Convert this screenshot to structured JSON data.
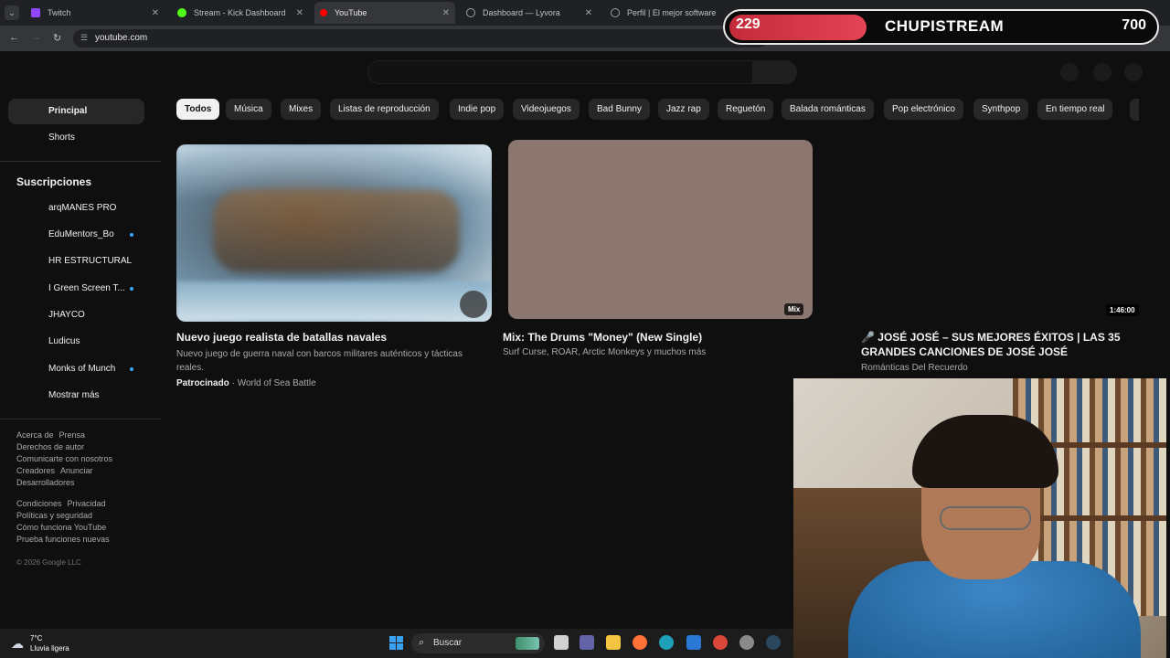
{
  "browser": {
    "tabs": [
      {
        "title": "Twitch",
        "color": "#9146ff"
      },
      {
        "title": "Stream - Kick Dashboard",
        "color": "#53fc18"
      },
      {
        "title": "YouTube",
        "color": "#ff0000"
      },
      {
        "title": "Dashboard — Lyvora",
        "color": "#9aa0a6"
      },
      {
        "title": "Perfil | El mejor software para p",
        "color": "#9aa0a6"
      }
    ],
    "url": "youtube.com"
  },
  "overlay": {
    "left_count": "229",
    "channel": "CHUPISTREAM",
    "right_count": "700"
  },
  "sidebar": {
    "main": [
      {
        "label": "Principal"
      },
      {
        "label": "Shorts"
      }
    ],
    "subs_title": "Suscripciones",
    "subs": [
      {
        "label": "arqMANES PRO",
        "dot": false
      },
      {
        "label": "EduMentors_Bo",
        "dot": true
      },
      {
        "label": "HR ESTRUCTURAL",
        "dot": false
      },
      {
        "label": "I Green Screen T...",
        "dot": true
      },
      {
        "label": "JHAYCO",
        "dot": false
      },
      {
        "label": "Ludicus",
        "dot": false
      },
      {
        "label": "Monks of Munch",
        "dot": true
      },
      {
        "label": "Mostrar más",
        "dot": false
      }
    ],
    "footer1": [
      "Acerca de",
      "Prensa",
      "Derechos de autor",
      "Comunicarte con nosotros",
      "Creadores",
      "Anunciar",
      "Desarrolladores"
    ],
    "footer2": [
      "Condiciones",
      "Privacidad",
      "Políticas y seguridad",
      "Cómo funciona YouTube",
      "Prueba funciones nuevas"
    ],
    "copyright": "© 2026 Google LLC"
  },
  "chips": [
    "Todos",
    "Música",
    "Mixes",
    "Listas de reproducción",
    "Indie pop",
    "Videojuegos",
    "Bad Bunny",
    "Jazz rap",
    "Reguetón",
    "Balada románticas",
    "Pop electrónico",
    "Synthpop",
    "En tiempo real"
  ],
  "videos": [
    {
      "title": "Nuevo juego realista de batallas navales",
      "desc": "Nuevo juego de guerra naval con barcos militares auténticos y tácticas reales.",
      "sponsor": "Patrocinado",
      "channel": "World of Sea Battle"
    },
    {
      "title": "Mix: The Drums \"Money\" (New Single)",
      "meta": "Surf Curse, ROAR, Arctic Monkeys y muchos más",
      "badge": "Mix"
    },
    {
      "title": "🎤 JOSÉ JOSÉ – SUS MEJORES ÉXITOS | LAS 35 GRANDES CANCIONES DE JOSÉ JOSÉ",
      "meta": "Románticas Del Recuerdo",
      "duration": "1:46:00"
    }
  ],
  "taskbar": {
    "temp": "7°C",
    "weather": "Lluvia ligera",
    "search": "Buscar"
  }
}
